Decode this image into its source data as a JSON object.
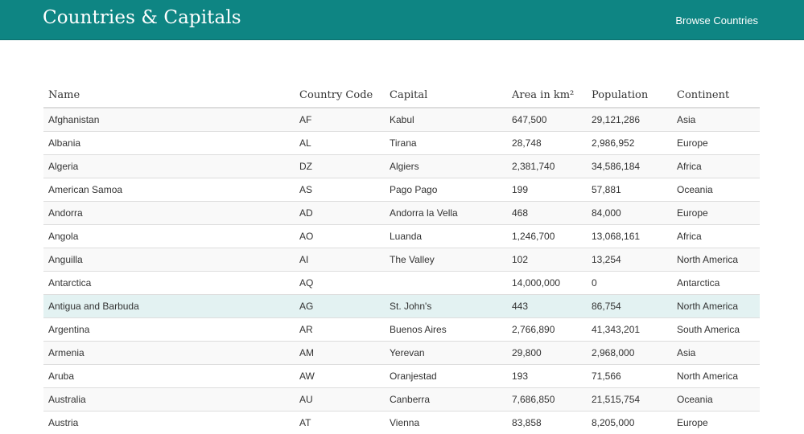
{
  "navbar": {
    "brand": "Countries & Capitals",
    "browse_link": "Browse Countries"
  },
  "table": {
    "columns": [
      "Name",
      "Country Code",
      "Capital",
      "Area in km²",
      "Population",
      "Continent"
    ],
    "rows": [
      [
        "Afghanistan",
        "AF",
        "Kabul",
        "647,500",
        "29,121,286",
        "Asia"
      ],
      [
        "Albania",
        "AL",
        "Tirana",
        "28,748",
        "2,986,952",
        "Europe"
      ],
      [
        "Algeria",
        "DZ",
        "Algiers",
        "2,381,740",
        "34,586,184",
        "Africa"
      ],
      [
        "American Samoa",
        "AS",
        "Pago Pago",
        "199",
        "57,881",
        "Oceania"
      ],
      [
        "Andorra",
        "AD",
        "Andorra la Vella",
        "468",
        "84,000",
        "Europe"
      ],
      [
        "Angola",
        "AO",
        "Luanda",
        "1,246,700",
        "13,068,161",
        "Africa"
      ],
      [
        "Anguilla",
        "AI",
        "The Valley",
        "102",
        "13,254",
        "North America"
      ],
      [
        "Antarctica",
        "AQ",
        "",
        "14,000,000",
        "0",
        "Antarctica"
      ],
      [
        "Antigua and Barbuda",
        "AG",
        "St. John's",
        "443",
        "86,754",
        "North America"
      ],
      [
        "Argentina",
        "AR",
        "Buenos Aires",
        "2,766,890",
        "41,343,201",
        "South America"
      ],
      [
        "Armenia",
        "AM",
        "Yerevan",
        "29,800",
        "2,968,000",
        "Asia"
      ],
      [
        "Aruba",
        "AW",
        "Oranjestad",
        "193",
        "71,566",
        "North America"
      ],
      [
        "Australia",
        "AU",
        "Canberra",
        "7,686,850",
        "21,515,754",
        "Oceania"
      ],
      [
        "Austria",
        "AT",
        "Vienna",
        "83,858",
        "8,205,000",
        "Europe"
      ]
    ]
  }
}
